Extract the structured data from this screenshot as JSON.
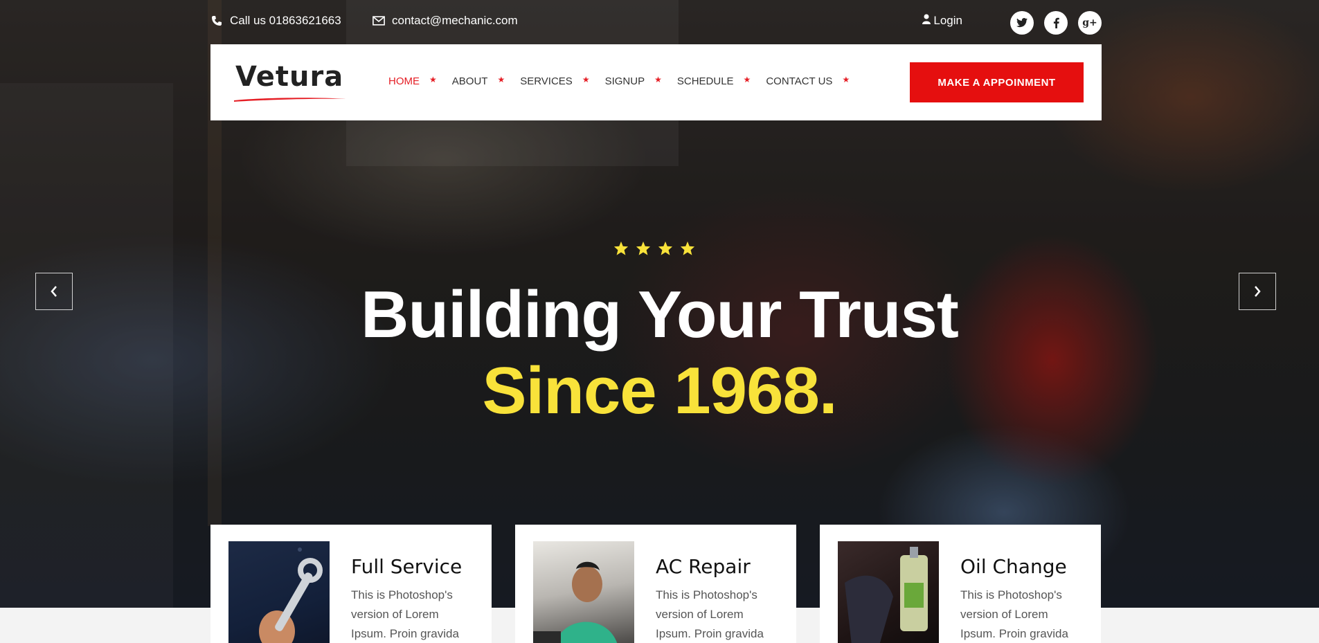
{
  "colors": {
    "accent": "#e50f0f",
    "highlight": "#f8e23a",
    "text_dark": "#222222",
    "white": "#ffffff"
  },
  "topbar": {
    "phone_icon": "phone-icon",
    "phone": "Call us 01863621663",
    "email_icon": "envelope-icon",
    "email": "contact@mechanic.com",
    "login_icon": "user-icon",
    "login": "Login",
    "social": [
      {
        "icon": "twitter-icon",
        "glyph": "t"
      },
      {
        "icon": "facebook-icon",
        "glyph": "f"
      },
      {
        "icon": "google-plus-icon",
        "glyph": "g+"
      }
    ]
  },
  "logo": {
    "text": "Vetura"
  },
  "nav": {
    "items": [
      {
        "label": "HOME",
        "active": true
      },
      {
        "label": "ABOUT",
        "active": false
      },
      {
        "label": "SERVICES",
        "active": false
      },
      {
        "label": "SIGNUP",
        "active": false
      },
      {
        "label": "SCHEDULE",
        "active": false
      },
      {
        "label": "CONTACT US",
        "active": false
      }
    ],
    "cta": "MAKE A APPOINMENT"
  },
  "hero": {
    "rating": 4,
    "headline": "Building Your Trust",
    "subline": "Since 1968.",
    "prev_icon": "chevron-left-icon",
    "next_icon": "chevron-right-icon"
  },
  "services": [
    {
      "title": "Full Service",
      "text": "This is Photoshop's version of Lorem Ipsum. Proin gravida"
    },
    {
      "title": "AC Repair",
      "text": "This is Photoshop's version of Lorem Ipsum. Proin gravida"
    },
    {
      "title": "Oil Change",
      "text": "This is Photoshop's version of Lorem Ipsum. Proin gravida"
    }
  ]
}
